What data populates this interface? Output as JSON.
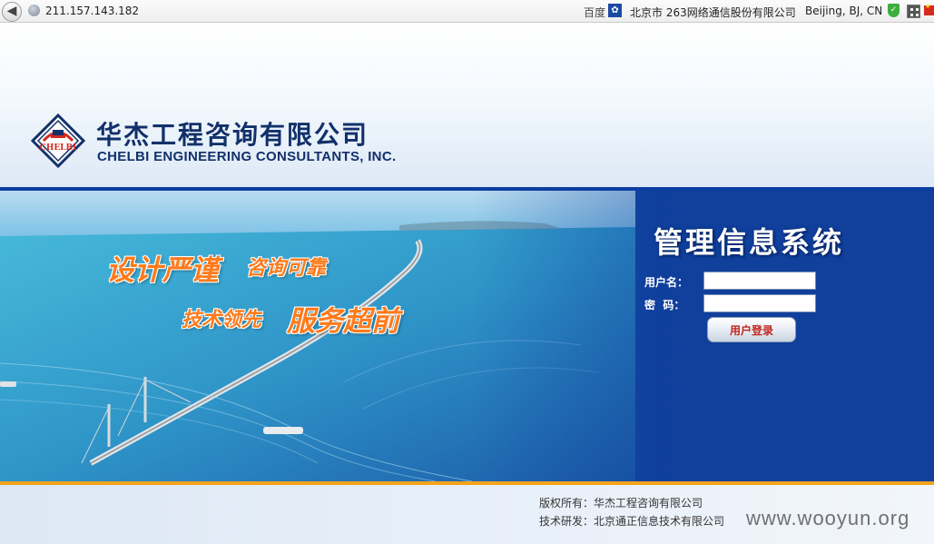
{
  "browser": {
    "url": "211.157.143.182",
    "baidu_label": "百度",
    "isp": "北京市 263网络通信股份有限公司",
    "location": "Beijing, BJ, CN"
  },
  "header": {
    "logo_text": "CHELBI",
    "company_name_cn": "华杰工程咨询有限公司",
    "company_name_en": "CHELBI ENGINEERING CONSULTANTS, INC."
  },
  "banner": {
    "slogans": [
      "设计严谨",
      "咨询可靠",
      "技术领先",
      "服务超前"
    ]
  },
  "login": {
    "title": "管理信息系统",
    "username_label": "用户名：",
    "password_label": "密  码：",
    "username_value": "",
    "password_value": "",
    "submit_label": "用户登录"
  },
  "footer": {
    "copyright": "版权所有：华杰工程咨询有限公司",
    "developer": "技术研发：北京通正信息技术有限公司"
  },
  "watermark": "www.wooyun.org",
  "colors": {
    "brand_navy": "#12306a",
    "slogan_orange": "#ff7a1a",
    "footer_accent": "#f2a31c",
    "button_text": "#c2261c"
  }
}
